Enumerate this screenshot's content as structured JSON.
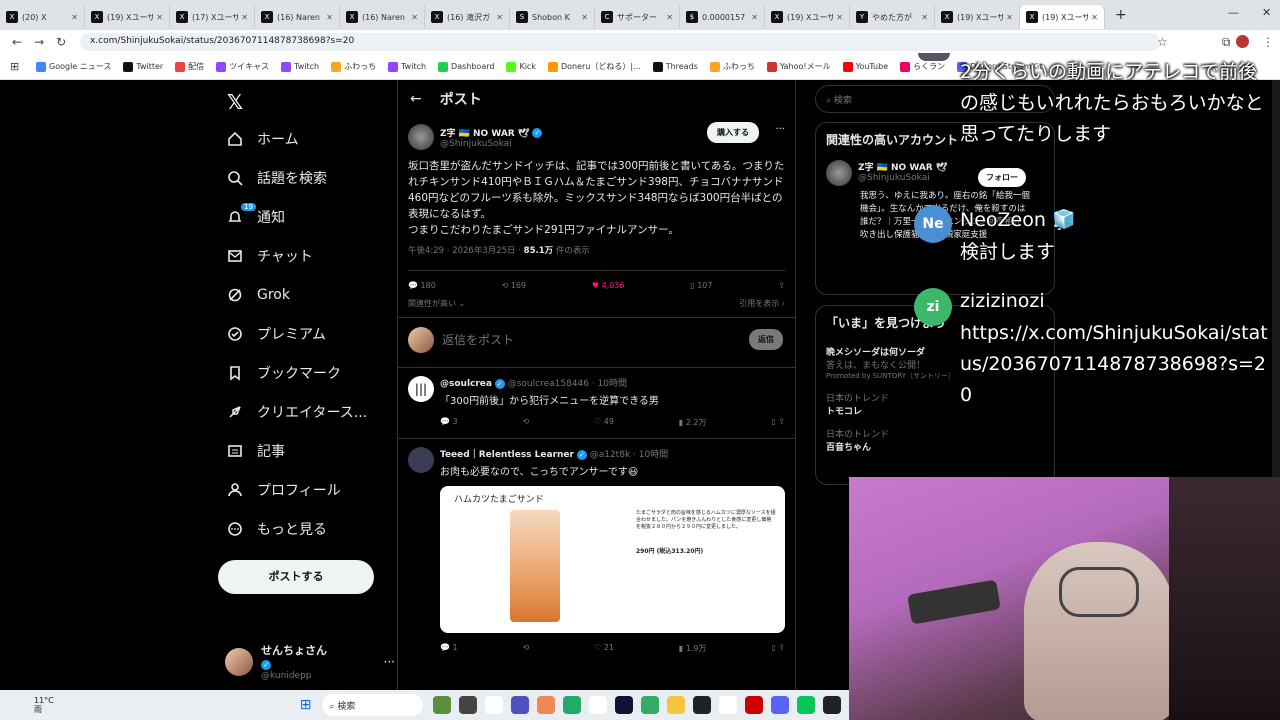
{
  "browser": {
    "tabs": [
      {
        "label": "(20) X",
        "icon": "X",
        "active": false
      },
      {
        "label": "(19) Xユーザー",
        "icon": "X",
        "active": false
      },
      {
        "label": "(17) Xユーザー",
        "icon": "X",
        "active": false
      },
      {
        "label": "(16) Naren",
        "icon": "X",
        "active": false
      },
      {
        "label": "(16) Naren",
        "icon": "X",
        "active": false
      },
      {
        "label": "(16) 滝沢ガ",
        "icon": "X",
        "active": false
      },
      {
        "label": "Shobon K",
        "icon": "S",
        "active": false
      },
      {
        "label": "サポーター",
        "icon": "C",
        "active": false
      },
      {
        "label": "0.0000157",
        "icon": "$",
        "active": false
      },
      {
        "label": "(19) Xユーザー",
        "icon": "X",
        "active": false
      },
      {
        "label": "やめた方が",
        "icon": "Y",
        "active": false
      },
      {
        "label": "(19) Xユーザー",
        "icon": "X",
        "active": false
      },
      {
        "label": "(19) Xユーザー",
        "icon": "X",
        "active": true
      }
    ],
    "url": "x.com/ShinjukuSokai/status/2036707114878738698?s=20",
    "bookmarks": [
      "Google ニュース",
      "Twitter",
      "配信",
      "ツイキャス",
      "Twitch",
      "ふわっち",
      "Twitch",
      "Dashboard",
      "Kick",
      "Doneru（どねる）|...",
      "Threads",
      "ふわっち",
      "Yahoo!メール",
      "YouTube",
      "らくラン",
      "Discord StreamKit"
    ]
  },
  "nav": {
    "items": [
      {
        "label": "ホーム",
        "icon": "home-icon"
      },
      {
        "label": "話題を検索",
        "icon": "search-icon"
      },
      {
        "label": "通知",
        "icon": "bell-icon",
        "badge": "19"
      },
      {
        "label": "チャット",
        "icon": "mail-icon"
      },
      {
        "label": "Grok",
        "icon": "grok-icon"
      },
      {
        "label": "プレミアム",
        "icon": "verified-icon"
      },
      {
        "label": "ブックマーク",
        "icon": "bookmark-icon"
      },
      {
        "label": "クリエイタース...",
        "icon": "rocket-icon"
      },
      {
        "label": "記事",
        "icon": "article-icon"
      },
      {
        "label": "プロフィール",
        "icon": "person-icon"
      },
      {
        "label": "もっと見る",
        "icon": "more-icon"
      }
    ],
    "post_button": "ポストする",
    "user_name": "せんちょさん",
    "user_handle": "@kunidepp"
  },
  "timeline": {
    "header": "ポスト",
    "post": {
      "author": "Z字 🇺🇦 NO WAR 🕊",
      "handle": "@ShinjukuSokai",
      "buy_label": "購入する",
      "text": "坂口杏里が盗んだサンドイッチは、記事では300円前後と書いてある。つまりたれチキンサンド410円やＢＩＧハム＆たまごサンド398円、チョコバナナサンド460円などのフルーツ系も除外。ミックスサンド348円ならば300円台半ばとの表現になるはず。\nつまりこだわりたまごサンド291円ファイナルアンサー。",
      "time": "午後4:29 · 2026年3月25日 · ",
      "views": "85.1万",
      "views_suffix": " 件の表示",
      "replies": "180",
      "reposts": "169",
      "likes": "4,036",
      "bookmarks": "107",
      "sort_label": "関連性が高い",
      "quotes_label": "引用を表示 ›"
    },
    "composer": {
      "placeholder": "返信をポスト",
      "button": "返信"
    },
    "replies": [
      {
        "name": "@soulcrea",
        "handle": "@soulcrea158446 · 10時間",
        "text": "「300円前後」から犯行メニューを逆算できる男",
        "replies": "3",
        "likes": "49",
        "views": "2.2万"
      },
      {
        "name": "Teeed｜Relentless Learner",
        "handle": "@a12t8k · 10時間",
        "text": "お肉も必要なので、こっちでアンサーです😃",
        "replies": "1",
        "likes": "21",
        "views": "1.9万",
        "image": {
          "title": "ハムカツたまごサンド",
          "desc": "たまごサラダと肉の旨味を感じるハムカツに濃厚なソースを組合わせました。パンを焼きふんわりとした食感に変更し価格を税抜２８０円から２９０円に変更しました。",
          "price": "290円 (税込313.20円)"
        }
      }
    ]
  },
  "right": {
    "search_placeholder": "検索",
    "related_title": "関連性の高いアカウント",
    "related_name": "Z字 🇺🇦 NO WAR 🕊",
    "related_handle": "@ShinjukuSokai",
    "follow": "フォロー",
    "related_bio": "我思う、ゆえに我あり。座右の銘「給我一個機会」。生なんかで出るだけ、俺を殺すのは誰だ？｜万里一空｜背水ンサロン新宿租界｜吹き出し保護猫ひとり親家庭支援",
    "now_title": "「いま」を見つけよう",
    "trends": [
      {
        "context": "晩メシソーダは何ソーダ",
        "name": "答えは、まもなく公開！",
        "sub": "Promoted by SUNTORY（サントリー）"
      },
      {
        "context": "日本のトレンド",
        "name": "トモコレ"
      },
      {
        "context": "日本のトレンド",
        "name": "百音ちゃん"
      }
    ]
  },
  "chat": {
    "messages": [
      {
        "user": "",
        "text": "2分くらいの動画にアテレコで前後の感じもいれれたらおもろいかなと思ってたりします"
      },
      {
        "user": "NeoZeon 🧊",
        "avatar": "Ne",
        "color": "#4a8fd4",
        "text": "検討します"
      },
      {
        "user": "zizizinozi",
        "avatar": "zi",
        "color": "#3cb86b",
        "text": "https://x.com/ShinjukuSokai/status/2036707114878738698?s=20"
      }
    ]
  },
  "taskbar": {
    "weather": "11°C",
    "weather_sub": "雨",
    "search": "検索"
  }
}
